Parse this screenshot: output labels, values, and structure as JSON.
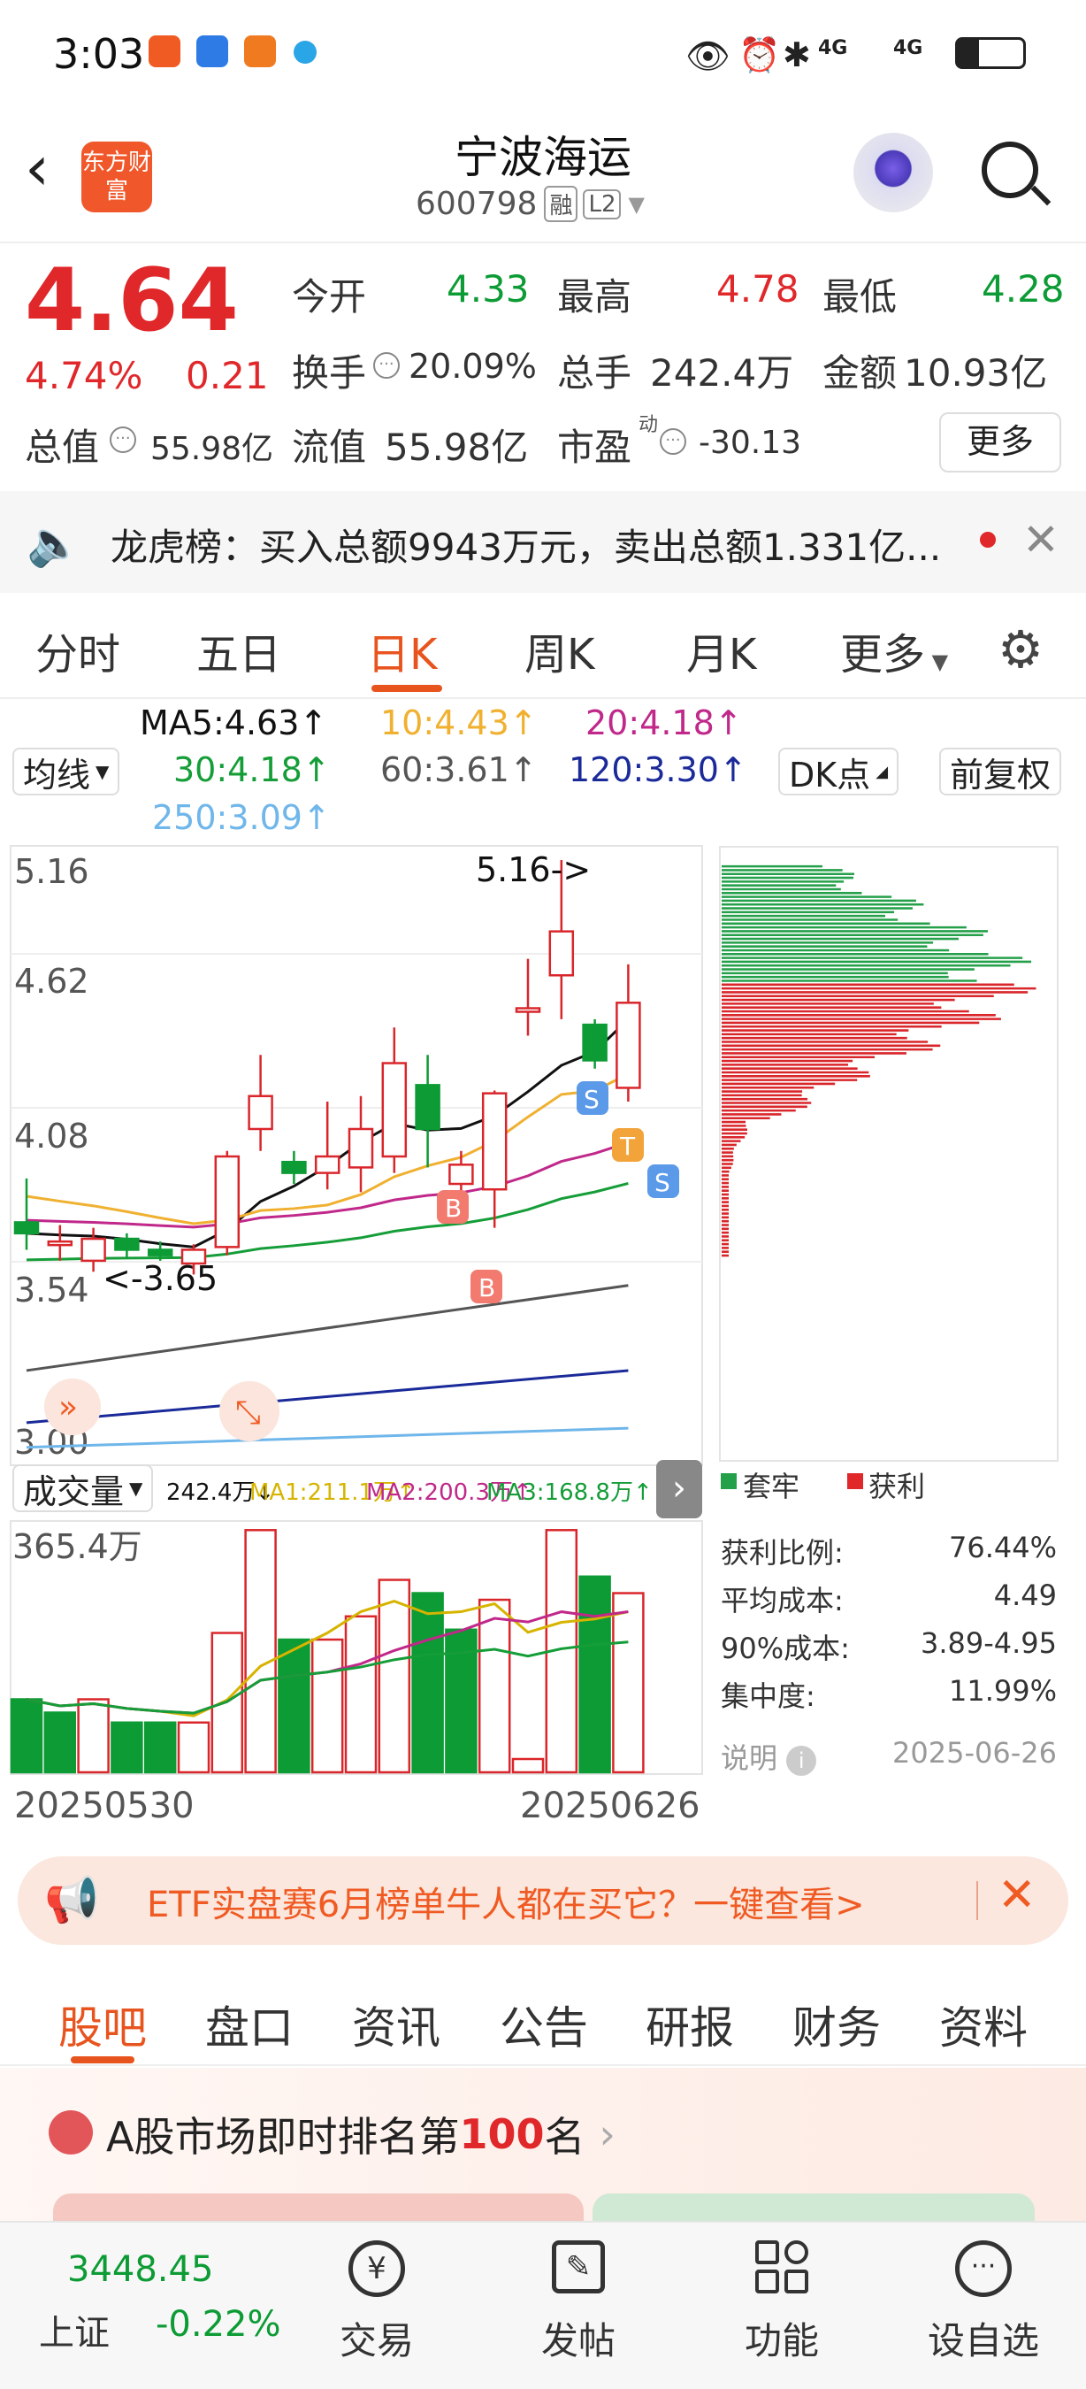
{
  "status_bar": {
    "time": "3:03",
    "signal1": "4G",
    "signal2": "4G"
  },
  "header": {
    "title": "宁波海运",
    "code": "600798",
    "badge_rong": "融",
    "badge_l2": "L2",
    "logo_text": "东方财富"
  },
  "quote": {
    "price": "4.64",
    "pct": "4.74%",
    "change": "0.21",
    "open_label": "今开",
    "open": "4.33",
    "high_label": "最高",
    "high": "4.78",
    "low_label": "最低",
    "low": "4.28",
    "turnover_label": "换手",
    "turnover": "20.09%",
    "volume_label": "总手",
    "volume": "242.4万",
    "amount_label": "金额",
    "amount": "10.93亿",
    "mktcap_label": "总值",
    "mktcap": "55.98亿",
    "float_label": "流值",
    "float": "55.98亿",
    "pe_label": "市盈",
    "pe_sup": "动",
    "pe": "-30.13",
    "more_button": "更多"
  },
  "ticker": {
    "text": "龙虎榜：买入总额9943万元，卖出总额1.331亿..."
  },
  "chart_tabs": [
    "分时",
    "五日",
    "日K",
    "周K",
    "月K",
    "更多"
  ],
  "ma_legend": {
    "ma5": "MA5:4.63",
    "ma10": "10:4.43",
    "ma20": "20:4.18",
    "ma30": "30:4.18",
    "ma60": "60:3.61",
    "ma120": "120:3.30",
    "ma250": "250:3.09",
    "jx": "均线",
    "dk": "DK点",
    "fq": "前复权"
  },
  "colors": {
    "ma5": "#111111",
    "ma10": "#f0b030",
    "ma20": "#c0288a",
    "ma30": "#159d38",
    "ma60": "#555555",
    "ma120": "#1a2a99",
    "ma250": "#6fb6ea",
    "up": "#d9262b",
    "down": "#0c9b34"
  },
  "chart_data": {
    "type": "candlestick",
    "y_ticks": [
      "5.16",
      "4.62",
      "4.08",
      "3.54",
      "3.00"
    ],
    "ylim": [
      3.0,
      5.16
    ],
    "high_label": "5.16->",
    "low_label": "<-3.65",
    "candles": [
      {
        "o": 3.84,
        "h": 4.0,
        "l": 3.74,
        "c": 3.8
      },
      {
        "o": 3.77,
        "h": 3.83,
        "l": 3.7,
        "c": 3.77
      },
      {
        "o": 3.7,
        "h": 3.82,
        "l": 3.66,
        "c": 3.78
      },
      {
        "o": 3.78,
        "h": 3.8,
        "l": 3.71,
        "c": 3.74
      },
      {
        "o": 3.74,
        "h": 3.77,
        "l": 3.7,
        "c": 3.72
      },
      {
        "o": 3.69,
        "h": 3.76,
        "l": 3.65,
        "c": 3.74
      },
      {
        "o": 3.75,
        "h": 4.1,
        "l": 3.72,
        "c": 4.08
      },
      {
        "o": 4.18,
        "h": 4.45,
        "l": 4.1,
        "c": 4.3
      },
      {
        "o": 4.06,
        "h": 4.1,
        "l": 3.98,
        "c": 4.02
      },
      {
        "o": 4.02,
        "h": 4.28,
        "l": 3.96,
        "c": 4.08
      },
      {
        "o": 4.04,
        "h": 4.3,
        "l": 3.95,
        "c": 4.18
      },
      {
        "o": 4.08,
        "h": 4.55,
        "l": 4.02,
        "c": 4.42
      },
      {
        "o": 4.34,
        "h": 4.45,
        "l": 4.04,
        "c": 4.18
      },
      {
        "o": 3.98,
        "h": 4.1,
        "l": 3.9,
        "c": 4.05
      },
      {
        "o": 3.96,
        "h": 4.32,
        "l": 3.82,
        "c": 4.31
      },
      {
        "o": 4.62,
        "h": 4.8,
        "l": 4.52,
        "c": 4.62
      },
      {
        "o": 4.74,
        "h": 5.16,
        "l": 4.58,
        "c": 4.9
      },
      {
        "o": 4.56,
        "h": 4.58,
        "l": 4.4,
        "c": 4.43
      },
      {
        "o": 4.33,
        "h": 4.78,
        "l": 4.28,
        "c": 4.64
      }
    ],
    "volume": {
      "y_label": "365.4万",
      "values": [
        110,
        90,
        110,
        75,
        75,
        75,
        210,
        365,
        200,
        200,
        235,
        290,
        270,
        215,
        260,
        20,
        365,
        295,
        270
      ],
      "up": [
        false,
        false,
        true,
        false,
        false,
        true,
        true,
        true,
        false,
        true,
        true,
        true,
        false,
        false,
        true,
        true,
        true,
        false,
        true
      ],
      "legend_vol": "242.4万",
      "ma1": "MA1:211.1万",
      "ma2": "MA2:200.3万",
      "ma3": "MA3:168.8万",
      "label": "成交量"
    },
    "x_labels": [
      "20250530",
      "20250626"
    ],
    "profile_legend": {
      "trapped": "套牢",
      "profit": "获利"
    }
  },
  "profile_stats": [
    {
      "label": "获利比例:",
      "value": "76.44%"
    },
    {
      "label": "平均成本:",
      "value": "4.49"
    },
    {
      "label": "90%成本:",
      "value": "3.89-4.95"
    },
    {
      "label": "集中度:",
      "value": "11.99%"
    }
  ],
  "profile_note": {
    "label": "说明",
    "date": "2025-06-26"
  },
  "markers": {
    "b": "B",
    "s": "S",
    "t": "T"
  },
  "banner": {
    "text": "ETF实盘赛6月榜单牛人都在买它？一键查看>"
  },
  "bottom_tabs": [
    "股吧",
    "盘口",
    "资讯",
    "公告",
    "研报",
    "财务",
    "资料"
  ],
  "rank": {
    "prefix": "A股市场即时排名第",
    "num": "100",
    "suffix": "名"
  },
  "index": {
    "value": "3448.45",
    "name": "上证",
    "pct": "-0.22%"
  },
  "nav": [
    {
      "label": "交易"
    },
    {
      "label": "发帖"
    },
    {
      "label": "功能"
    },
    {
      "label": "设自选"
    }
  ]
}
